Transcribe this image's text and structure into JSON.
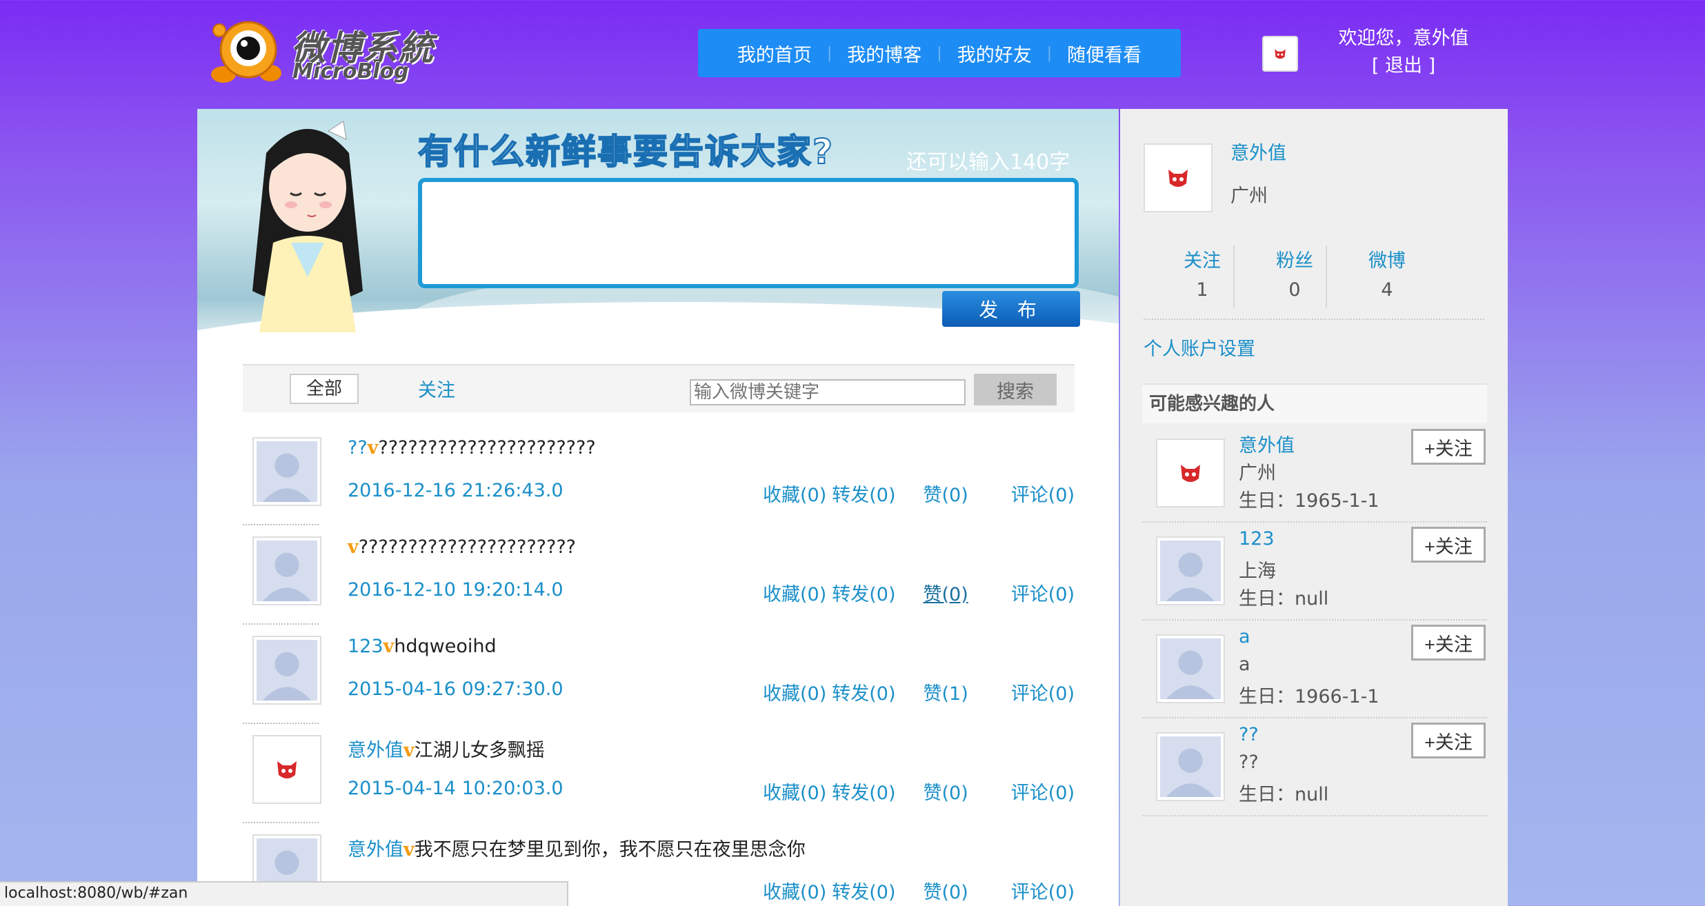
{
  "header": {
    "logo_cn": "微博系統",
    "logo_en": "MicroBlog",
    "nav": [
      "我的首页",
      "我的博客",
      "我的好友",
      "随便看看"
    ],
    "welcome_line1": "欢迎您，意外值",
    "logout": "[ 退出 ]"
  },
  "composer": {
    "prompt": "有什么新鲜事要告诉大家?",
    "remaining": "还可以输入140字",
    "publish": "发 布"
  },
  "filter": {
    "tab_all": "全部",
    "tab_follow": "关注",
    "search_placeholder": "输入微博关键字",
    "search_button": "搜索"
  },
  "posts": [
    {
      "author": "??",
      "badge": "v",
      "text": "??????????????????????",
      "time": "2016-12-16 21:26:43.0",
      "fav": "收藏(0)",
      "repost": "转发(0)",
      "like": "赞(0)",
      "comment": "评论(0)"
    },
    {
      "author": "",
      "badge": "v",
      "text": "??????????????????????",
      "time": "2016-12-10 19:20:14.0",
      "fav": "收藏(0)",
      "repost": "转发(0)",
      "like": "赞(0)",
      "comment": "评论(0)"
    },
    {
      "author": "123",
      "badge": "v",
      "text": "hdqweoihd",
      "time": "2015-04-16 09:27:30.0",
      "fav": "收藏(0)",
      "repost": "转发(0)",
      "like": "赞(1)",
      "comment": "评论(0)"
    },
    {
      "author": "意外值",
      "badge": "v",
      "text": "江湖儿女多飘摇",
      "time": "2015-04-14 10:20:03.0",
      "fav": "收藏(0)",
      "repost": "转发(0)",
      "like": "赞(0)",
      "comment": "评论(0)"
    },
    {
      "author": "意外值",
      "badge": "v",
      "text": "我不愿只在梦里见到你，我不愿只在夜里思念你",
      "time": "",
      "fav": "收藏(0)",
      "repost": "转发(0)",
      "like": "赞(0)",
      "comment": "评论(0)"
    }
  ],
  "profile": {
    "name": "意外值",
    "city": "广州",
    "stats": [
      {
        "label": "关注",
        "value": "1"
      },
      {
        "label": "粉丝",
        "value": "0"
      },
      {
        "label": "微博",
        "value": "4"
      }
    ],
    "account_settings": "个人账户设置"
  },
  "suggestions": {
    "heading": "可能感兴趣的人",
    "follow_label": "+关注",
    "people": [
      {
        "name": "意外值",
        "city": "广州",
        "birthday": "生日：1965-1-1"
      },
      {
        "name": "123",
        "city": "上海",
        "birthday": "生日：null"
      },
      {
        "name": "a",
        "city": "a",
        "birthday": "生日：1966-1-1"
      },
      {
        "name": "??",
        "city": "??",
        "birthday": "生日：null"
      }
    ]
  },
  "statusbar": {
    "url": "localhost:8080/wb/#zan"
  },
  "colors": {
    "nav_bg": "#1d8cf5",
    "link": "#1a8fc9",
    "badge": "#f39c12"
  }
}
